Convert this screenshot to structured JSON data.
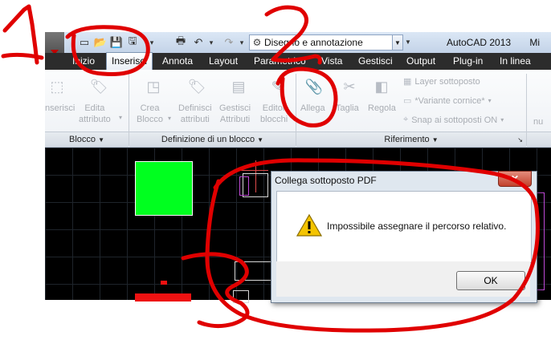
{
  "window": {
    "title": "AutoCAD 2013",
    "title_suffix": "Mi"
  },
  "workspace": {
    "selected": "Disegno e annotazione"
  },
  "tabs": [
    {
      "label": "Inizio",
      "active": false
    },
    {
      "label": "Inserisci",
      "active": true
    },
    {
      "label": "Annota",
      "active": false
    },
    {
      "label": "Layout",
      "active": false
    },
    {
      "label": "Parametrico",
      "active": false
    },
    {
      "label": "Vista",
      "active": false
    },
    {
      "label": "Gestisci",
      "active": false
    },
    {
      "label": "Output",
      "active": false
    },
    {
      "label": "Plug-in",
      "active": false
    },
    {
      "label": "In linea",
      "active": false
    }
  ],
  "ribbon": {
    "blocco": {
      "panel": "Blocco",
      "inserisci": "nserisci",
      "edita_1": "Edita",
      "edita_2": "attributo"
    },
    "definizione": {
      "panel": "Definizione di un blocco",
      "crea_1": "Crea",
      "crea_2": "Blocco",
      "definisci_1": "Definisci",
      "definisci_2": "attributi",
      "gestisci_1": "Gestisci",
      "gestisci_2": "Attributi",
      "editor_1": "Editor",
      "editor_2": "blocchi"
    },
    "riferimento": {
      "panel": "Riferimento",
      "allega": "Allega",
      "taglia": "Taglia",
      "regola": "Regola",
      "layer": "Layer sottoposto",
      "variante": "*Variante cornice*",
      "snap": "Snap ai sottoposti ON"
    },
    "overflow": "nu"
  },
  "dialog": {
    "title": "Collega sottoposto PDF",
    "close": "✕",
    "message": "Impossibile assegnare il percorso relativo.",
    "ok": "OK"
  },
  "colors": {
    "annotation": "#e00000",
    "green_block": "#00ff1f",
    "canvas": "#000000"
  }
}
